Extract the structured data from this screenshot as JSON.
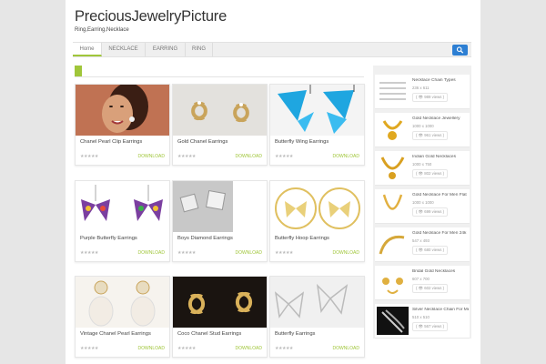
{
  "site": {
    "title": "PreciousJewelryPicture",
    "tagline": "Ring,Earring,Necklace"
  },
  "nav": {
    "items": [
      "Home",
      "NECKLACE",
      "EARRING",
      "RING"
    ],
    "active": 0
  },
  "colors": {
    "accent": "#a0c63a",
    "search_button": "#2d7fd3"
  },
  "search": {
    "icon": "search-icon"
  },
  "cards": [
    {
      "title": "Chanel Pearl Clip Earrings",
      "rating": "★★★★★",
      "download": "DOWNLOAD"
    },
    {
      "title": "Gold Chanel Earrings",
      "rating": "★★★★★",
      "download": "DOWNLOAD"
    },
    {
      "title": "Butterfly Wing Earrings",
      "rating": "★★★★★",
      "download": "DOWNLOAD"
    },
    {
      "title": "Purple Butterfly Earrings",
      "rating": "★★★★★",
      "download": "DOWNLOAD"
    },
    {
      "title": "Boys Diamond Earrings",
      "rating": "★★★★★",
      "download": "DOWNLOAD"
    },
    {
      "title": "Butterfly Hoop Earrings",
      "rating": "★★★★★",
      "download": "DOWNLOAD"
    },
    {
      "title": "Vintage Chanel Pearl Earrings",
      "rating": "★★★★★",
      "download": "DOWNLOAD"
    },
    {
      "title": "Coco Chanel Stud Earrings",
      "rating": "★★★★★",
      "download": "DOWNLOAD"
    },
    {
      "title": "Butterfly Earrings",
      "rating": "★★★★★",
      "download": "DOWNLOAD"
    }
  ],
  "sidebar": [
    {
      "title": "Necklace Chain Types",
      "dims": "236 x 611",
      "views": "( 👁 989 views )"
    },
    {
      "title": "Gold Necklace Jewellery",
      "dims": "1000 x 1000",
      "views": "( 👁 961 views )"
    },
    {
      "title": "Indian Gold Necklaces",
      "dims": "1000 x 750",
      "views": "( 👁 802 views )"
    },
    {
      "title": "Gold Necklace For Men Flat",
      "dims": "1000 x 1000",
      "views": "( 👁 699 views )"
    },
    {
      "title": "Gold Necklace For Men 24k",
      "dims": "547 x 493",
      "views": "( 👁 680 views )"
    },
    {
      "title": "Bridal Gold Necklaces",
      "dims": "607 x 700",
      "views": "( 👁 602 views )"
    },
    {
      "title": "Silver Necklace Chain For Men",
      "dims": "510 x 510",
      "views": "( 👁 567 views )"
    }
  ]
}
